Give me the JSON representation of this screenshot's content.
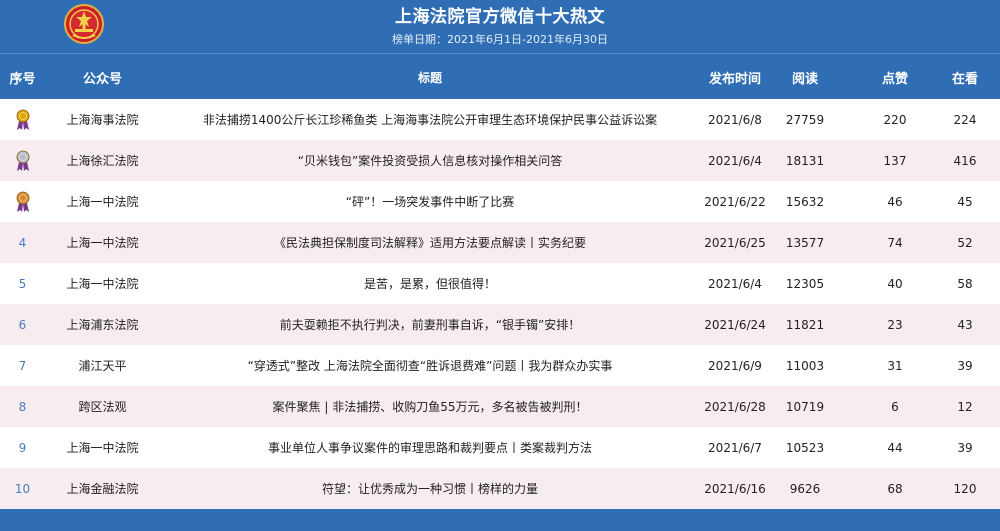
{
  "header": {
    "title": "上海法院官方微信十大热文",
    "date_range": "榜单日期：2021年6月1日-2021年6月30日",
    "emblem_icon": "court-emblem-icon"
  },
  "columns": {
    "rank": "序号",
    "account": "公众号",
    "title": "标题",
    "date": "发布时间",
    "reads": "阅读",
    "likes": "点赞",
    "watching": "在看"
  },
  "colors": {
    "banner": "#2f6eb5",
    "row_alt": "#f7edf1",
    "rank_number": "#4a7cc0",
    "gold_medal": "#e0a800",
    "silver_medal": "#b8bcc4",
    "bronze_medal": "#d98a2b"
  },
  "rows": [
    {
      "rank": "1",
      "medal": "gold-medal-icon",
      "account": "上海海事法院",
      "title": "非法捕捞1400公斤长江珍稀鱼类 上海海事法院公开审理生态环境保护民事公益诉讼案",
      "date": "2021/6/8",
      "reads": "27759",
      "likes": "220",
      "watching": "224"
    },
    {
      "rank": "2",
      "medal": "silver-medal-icon",
      "account": "上海徐汇法院",
      "title": "“贝米钱包”案件投资受损人信息核对操作相关问答",
      "date": "2021/6/4",
      "reads": "18131",
      "likes": "137",
      "watching": "416"
    },
    {
      "rank": "3",
      "medal": "bronze-medal-icon",
      "account": "上海一中法院",
      "title": "“砰”！一场突发事件中断了比赛",
      "date": "2021/6/22",
      "reads": "15632",
      "likes": "46",
      "watching": "45"
    },
    {
      "rank": "4",
      "medal": "",
      "account": "上海一中法院",
      "title": "《民法典担保制度司法解释》适用方法要点解读丨实务纪要",
      "date": "2021/6/25",
      "reads": "13577",
      "likes": "74",
      "watching": "52"
    },
    {
      "rank": "5",
      "medal": "",
      "account": "上海一中法院",
      "title": "是苦，是累，但很值得！",
      "date": "2021/6/4",
      "reads": "12305",
      "likes": "40",
      "watching": "58"
    },
    {
      "rank": "6",
      "medal": "",
      "account": "上海浦东法院",
      "title": "前夫耍赖拒不执行判决，前妻刑事自诉，“银手镯”安排！",
      "date": "2021/6/24",
      "reads": "11821",
      "likes": "23",
      "watching": "43"
    },
    {
      "rank": "7",
      "medal": "",
      "account": "浦江天平",
      "title": "“穿透式”整改 上海法院全面彻查“胜诉退费难”问题丨我为群众办实事",
      "date": "2021/6/9",
      "reads": "11003",
      "likes": "31",
      "watching": "39"
    },
    {
      "rank": "8",
      "medal": "",
      "account": "跨区法观",
      "title": "案件聚焦 | 非法捕捞、收购刀鱼55万元，多名被告被判刑！",
      "date": "2021/6/28",
      "reads": "10719",
      "likes": "6",
      "watching": "12"
    },
    {
      "rank": "9",
      "medal": "",
      "account": "上海一中法院",
      "title": "事业单位人事争议案件的审理思路和裁判要点丨类案裁判方法",
      "date": "2021/6/7",
      "reads": "10523",
      "likes": "44",
      "watching": "39"
    },
    {
      "rank": "10",
      "medal": "",
      "account": "上海金融法院",
      "title": "符望：让优秀成为一种习惯丨榜样的力量",
      "date": "2021/6/16",
      "reads": "9626",
      "likes": "68",
      "watching": "120"
    }
  ]
}
